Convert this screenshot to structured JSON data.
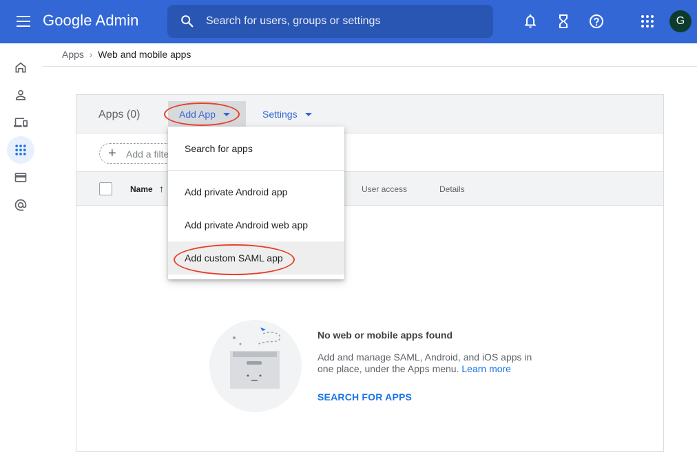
{
  "header": {
    "logo": "Google Admin",
    "search_placeholder": "Search for users, groups or settings",
    "avatar_initial": "G"
  },
  "breadcrumb": {
    "parent": "Apps",
    "separator": "›",
    "current": "Web and mobile apps"
  },
  "card": {
    "apps_count": "Apps (0)",
    "add_app_label": "Add App",
    "settings_label": "Settings",
    "filter_label": "Add a filter",
    "columns": {
      "name": "Name",
      "user_access": "User access",
      "details": "Details"
    }
  },
  "menu": {
    "items": [
      "Search for apps",
      "Add private Android app",
      "Add private Android web app",
      "Add custom SAML app"
    ]
  },
  "empty_state": {
    "title": "No web or mobile apps found",
    "description": "Add and manage SAML, Android, and iOS apps in one place, under the Apps menu.",
    "learn_more": "Learn more",
    "action": "SEARCH FOR APPS"
  },
  "colors": {
    "topbar": "#3367d6",
    "accent_link": "#1a73e8",
    "annotation": "#e8402a"
  },
  "icons": [
    "menu-icon",
    "search-icon",
    "bell-icon",
    "hourglass-icon",
    "help-icon",
    "apps-grid-icon",
    "home-icon",
    "user-icon",
    "devices-icon",
    "apps-icon",
    "billing-icon",
    "at-icon"
  ]
}
